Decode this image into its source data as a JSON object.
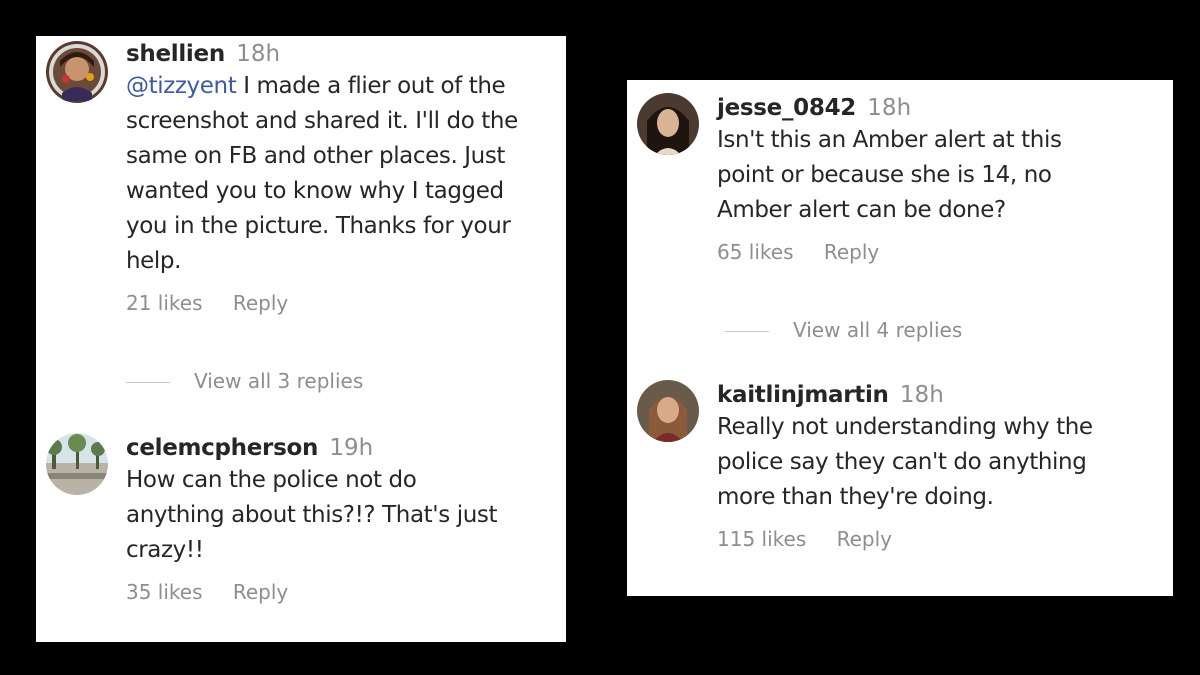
{
  "left": {
    "comments": [
      {
        "username": "shellien",
        "time": "18h",
        "mention": "@tizzyent",
        "text_lines": [
          "I made a flier out of the",
          "screenshot and shared it. I'll do the",
          "same on FB and other places. Just",
          "wanted you to know why I tagged",
          "you in the picture. Thanks for your",
          "help."
        ],
        "likes": "21 likes",
        "reply": "Reply",
        "view_replies": "View all 3 replies"
      },
      {
        "username": "celemcpherson",
        "time": "19h",
        "text_lines": [
          "How can the police not do",
          "anything about this?!? That's just",
          "crazy!!"
        ],
        "likes": "35 likes",
        "reply": "Reply"
      }
    ]
  },
  "right": {
    "comments": [
      {
        "username": "jesse_0842",
        "time": "18h",
        "text_lines": [
          "Isn't this an Amber alert at this",
          "point or because she is 14, no",
          "Amber alert can be done?"
        ],
        "likes": "65 likes",
        "reply": "Reply",
        "view_replies": "View all 4 replies"
      },
      {
        "username": "kaitlinjmartin",
        "time": "18h",
        "text_lines": [
          "Really not understanding why the",
          "police say they can't do anything",
          "more than they're doing."
        ],
        "likes": "115 likes",
        "reply": "Reply"
      }
    ]
  },
  "colors": {
    "background": "#000000",
    "panel": "#ffffff",
    "text": "#262626",
    "muted": "#8e8e8e",
    "mention": "#3d5a99"
  },
  "icons": [
    "avatar-shellien",
    "avatar-celemcpherson",
    "avatar-jesse",
    "avatar-kaitlinjmartin"
  ]
}
